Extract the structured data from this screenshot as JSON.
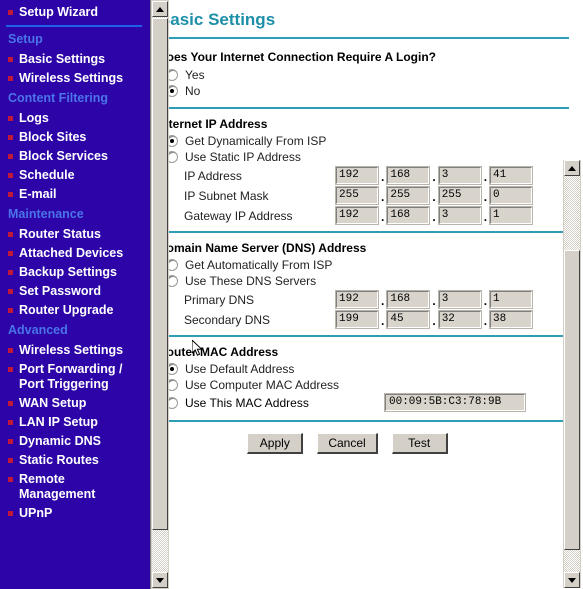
{
  "sidebar": {
    "top_item": {
      "label": "Setup Wizard"
    },
    "groups": [
      {
        "heading": "Setup",
        "items": [
          {
            "label": "Basic Settings"
          },
          {
            "label": "Wireless Settings"
          }
        ]
      },
      {
        "heading": "Content Filtering",
        "items": [
          {
            "label": "Logs"
          },
          {
            "label": "Block Sites"
          },
          {
            "label": "Block Services"
          },
          {
            "label": "Schedule"
          },
          {
            "label": "E-mail"
          }
        ]
      },
      {
        "heading": "Maintenance",
        "items": [
          {
            "label": "Router Status"
          },
          {
            "label": "Attached Devices"
          },
          {
            "label": "Backup Settings"
          },
          {
            "label": "Set Password"
          },
          {
            "label": "Router Upgrade"
          }
        ]
      },
      {
        "heading": "Advanced",
        "items": [
          {
            "label": "Wireless Settings"
          },
          {
            "label": "Port Forwarding /\nPort Triggering"
          },
          {
            "label": "WAN Setup"
          },
          {
            "label": "LAN IP Setup"
          },
          {
            "label": "Dynamic DNS"
          },
          {
            "label": "Static Routes"
          },
          {
            "label": "Remote\nManagement"
          },
          {
            "label": "UPnP"
          }
        ]
      }
    ]
  },
  "main": {
    "page_title": "Basic Settings",
    "login_question": {
      "label": "Does Your Internet Connection Require A Login?",
      "options": [
        {
          "label": "Yes",
          "selected": false
        },
        {
          "label": "No",
          "selected": true
        }
      ]
    },
    "internet_ip": {
      "heading": "Internet IP Address",
      "options": [
        {
          "label": "Get Dynamically From ISP",
          "selected": true
        },
        {
          "label": "Use Static IP Address",
          "selected": false
        }
      ],
      "fields": [
        {
          "label": "IP Address",
          "octets": [
            "192",
            "168",
            "3",
            "41"
          ]
        },
        {
          "label": "IP Subnet Mask",
          "octets": [
            "255",
            "255",
            "255",
            "0"
          ]
        },
        {
          "label": "Gateway IP Address",
          "octets": [
            "192",
            "168",
            "3",
            "1"
          ]
        }
      ]
    },
    "dns": {
      "heading": "Domain Name Server (DNS) Address",
      "options": [
        {
          "label": "Get Automatically From ISP",
          "selected": false
        },
        {
          "label": "Use These DNS Servers",
          "selected": false
        }
      ],
      "fields": [
        {
          "label": "Primary DNS",
          "octets": [
            "192",
            "168",
            "3",
            "1"
          ]
        },
        {
          "label": "Secondary DNS",
          "octets": [
            "199",
            "45",
            "32",
            "38"
          ]
        }
      ]
    },
    "mac": {
      "heading": "Router MAC Address",
      "options": [
        {
          "label": "Use Default Address",
          "selected": true
        },
        {
          "label": "Use Computer MAC Address",
          "selected": false
        },
        {
          "label": "Use This MAC Address",
          "selected": false
        }
      ],
      "mac_value": "00:09:5B:C3:78:9B"
    },
    "buttons": [
      {
        "label": "Apply"
      },
      {
        "label": "Cancel"
      },
      {
        "label": "Test"
      }
    ]
  },
  "colors": {
    "sidebar_bg": "#2C04A8",
    "section_heading": "#4A74E8",
    "bullet": "#C01838",
    "title": "#1E8FA8",
    "rule": "#2E9EB4"
  }
}
